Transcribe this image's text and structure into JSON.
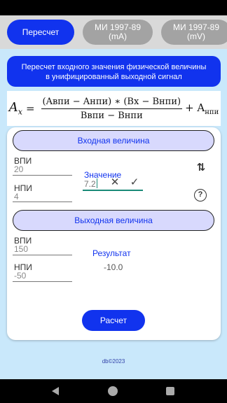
{
  "tabs": [
    {
      "label": "Пересчет"
    },
    {
      "label_line1": "МИ 1997-89",
      "label_line2": "(mA)"
    },
    {
      "label_line1": "МИ 1997-89",
      "label_line2": "(mV)"
    }
  ],
  "banner": {
    "line1": "Пересчет входного значения физической величины",
    "line2": "в унифицированный выходной сигнал"
  },
  "formula": {
    "lhs_main": "A",
    "lhs_sub": "x",
    "equals": "=",
    "numerator": "(Aвпи − Aнпи) ∗ (Bx − Bнпи)",
    "denominator": "Bвпи − Bнпи",
    "tail_plus": "+ A",
    "tail_sub": "нпи"
  },
  "input_section": {
    "title": "Входная величина",
    "vpi_label": "ВПИ",
    "vpi_value": "20",
    "npi_label": "НПИ",
    "npi_value": "4",
    "value_label": "Значение",
    "value": "7.2"
  },
  "output_section": {
    "title": "Выходная величина",
    "vpi_label": "ВПИ",
    "vpi_value": "150",
    "npi_label": "НПИ",
    "npi_value": "-50",
    "result_label": "Результат",
    "result_value": "-10.0"
  },
  "icons": {
    "clear": "close-icon",
    "confirm": "check-icon",
    "swap": "swap-vert-icon",
    "help": "help-icon"
  },
  "calc_button": "Расчет",
  "footer": "db©2023",
  "colors": {
    "accent": "#1133ee",
    "tab_inactive": "#a3a3a3",
    "pill_bg": "#d8d9fd",
    "background": "#c9e8fb",
    "focus": "#1a8a78"
  }
}
